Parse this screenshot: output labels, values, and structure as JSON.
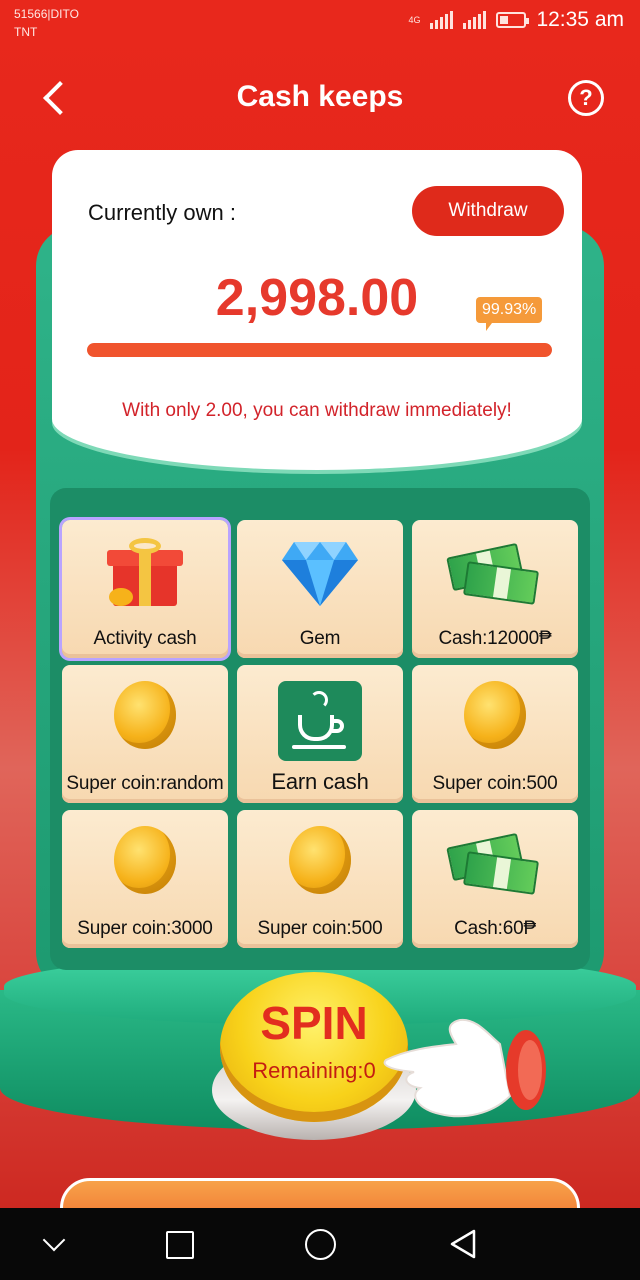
{
  "status_bar": {
    "carrier_line1": "51566|DITO",
    "carrier_line2": "TNT",
    "network_1": "4G",
    "time": "12:35 am"
  },
  "header": {
    "title": "Cash keeps",
    "back_icon": "chevron-left-icon",
    "help_label": "?"
  },
  "balance": {
    "label": "Currently own :",
    "withdraw_label": "Withdraw",
    "amount": "2,998.00",
    "progress_percent_text": "99.93%",
    "progress_fraction": 0.9993,
    "hint": "With only 2.00, you can withdraw immediately!"
  },
  "grid": {
    "items": [
      {
        "label": "Activity cash",
        "icon": "gift-icon",
        "active": true
      },
      {
        "label": "Gem",
        "icon": "gem-icon"
      },
      {
        "label": "Cash:12000₱",
        "icon": "cash-icon"
      },
      {
        "label": "Super coin:random",
        "icon": "coin-icon"
      },
      {
        "label": "Earn cash",
        "icon": "cup-icon"
      },
      {
        "label": "Super coin:500",
        "icon": "coin-icon"
      },
      {
        "label": "Super coin:3000",
        "icon": "coin-icon"
      },
      {
        "label": "Super coin:500",
        "icon": "coin-icon"
      },
      {
        "label": "Cash:60₱",
        "icon": "cash-icon"
      }
    ]
  },
  "spin": {
    "label": "SPIN",
    "remaining": "Remaining:0"
  },
  "colors": {
    "brand_red": "#e3241a",
    "accent_green": "#1d9a70",
    "amount_red": "#e6392c",
    "badge_orange": "#f59a3a"
  }
}
